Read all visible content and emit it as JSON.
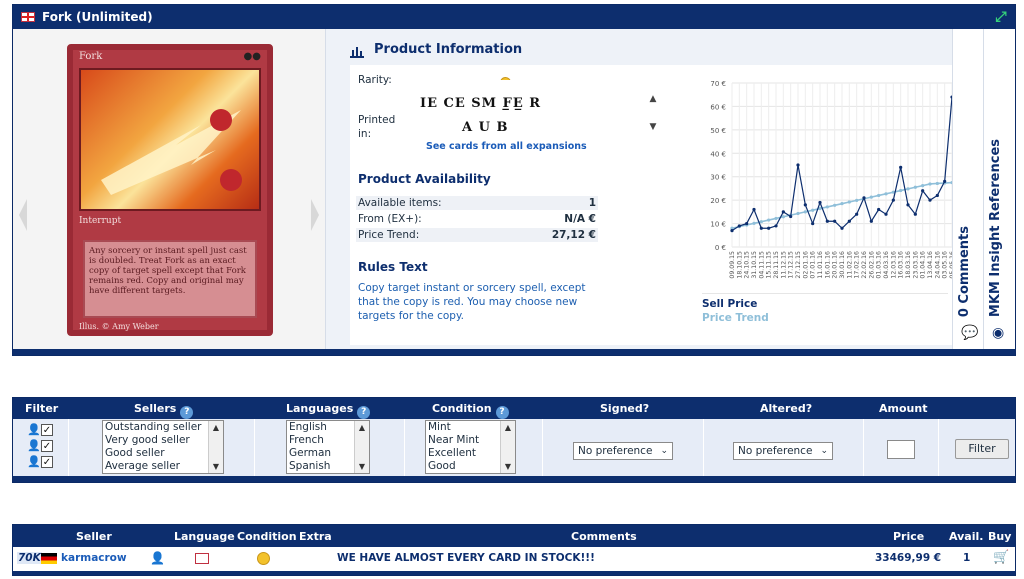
{
  "product": {
    "title": "Fork (Unlimited)",
    "card": {
      "name": "Fork",
      "cost": "●●",
      "type_line": "Interrupt",
      "text": "Any sorcery or instant spell just cast is doubled. Treat Fork as an exact copy of target spell except that Fork remains red. Copy and original may have different targets.",
      "illus": "Illus. © Amy Weber"
    }
  },
  "info": {
    "heading": "Product Information",
    "rarity_label": "Rarity:",
    "printed_label": "Printed in:",
    "expansions_row1": "IE CE SM F̲E̲ R",
    "expansions_row2": "A U B",
    "see_link": "See cards from all expansions",
    "availability_heading": "Product Availability",
    "rows": [
      {
        "key": "Available items:",
        "value": "1"
      },
      {
        "key": "From (EX+):",
        "value": "N/A €"
      },
      {
        "key": "Price Trend:",
        "value": "27,12 €"
      }
    ],
    "rules_heading": "Rules Text",
    "rules_text": "Copy target instant or sorcery spell, except that the copy is red. You may choose new targets for the copy."
  },
  "chart_data": {
    "type": "line",
    "y_ticks": [
      "70 €",
      "60 €",
      "50 €",
      "40 €",
      "30 €",
      "20 €",
      "10 €",
      "0 €"
    ],
    "ylim": [
      0,
      70
    ],
    "x": [
      "09.09.15",
      "18.10.15",
      "24.10.15",
      "31.10.15",
      "04.11.15",
      "15.11.15",
      "28.11.15",
      "11.12.15",
      "17.12.15",
      "27.12.15",
      "02.01.16",
      "07.01.16",
      "11.01.16",
      "16.01.16",
      "20.01.16",
      "30.01.16",
      "11.02.16",
      "17.02.16",
      "22.02.16",
      "26.02.16",
      "01.03.16",
      "04.03.16",
      "12.03.16",
      "16.03.16",
      "18.03.16",
      "23.03.16",
      "01.04.16",
      "13.04.16",
      "24.04.16",
      "03.05.16",
      "05.05.16"
    ],
    "series": [
      {
        "name": "Sell Price",
        "color": "#0d2e6e",
        "values": [
          7,
          9,
          10,
          16,
          8,
          8,
          9,
          15,
          13,
          35,
          18,
          10,
          19,
          11,
          11,
          8,
          11,
          14,
          21,
          11,
          16,
          14,
          20,
          34,
          18,
          14,
          24,
          20,
          22,
          28,
          64
        ]
      },
      {
        "name": "Price Trend",
        "color": "#8fbfd9",
        "values": [
          8,
          8.7,
          9.4,
          10.1,
          10.8,
          11.5,
          12.2,
          12.9,
          13.6,
          14.3,
          15,
          15.7,
          16.4,
          17.1,
          17.8,
          18.5,
          19.2,
          19.9,
          20.6,
          21.3,
          22,
          22.7,
          23.4,
          24.1,
          24.8,
          25.5,
          26.2,
          26.9,
          27.12,
          27.3,
          27.5
        ]
      }
    ],
    "legend_placement": "bottom",
    "grid": true
  },
  "side_tabs": {
    "comments": "0 Comments",
    "insight": "MKM Insight References"
  },
  "filter": {
    "headers": {
      "filter": "Filter",
      "sellers": "Sellers",
      "languages": "Languages",
      "condition": "Condition",
      "signed": "Signed?",
      "altered": "Altered?",
      "amount": "Amount"
    },
    "sellers": [
      "Outstanding seller",
      "Very good seller",
      "Good seller",
      "Average seller"
    ],
    "languages": [
      "English",
      "French",
      "German",
      "Spanish"
    ],
    "conditions": [
      "Mint",
      "Near Mint",
      "Excellent",
      "Good"
    ],
    "signed_value": "No preference",
    "altered_value": "No preference",
    "button": "Filter",
    "help": "?"
  },
  "offers": {
    "headers": {
      "seller": "Seller",
      "language": "Language",
      "condition": "Condition",
      "extra": "Extra",
      "comments": "Comments",
      "price": "Price",
      "avail": "Avail.",
      "buy": "Buy"
    },
    "rows": [
      {
        "sales": "70K",
        "seller": "karmacrow",
        "comment": "WE HAVE ALMOST EVERY CARD IN STOCK!!!",
        "price": "33469,99 €",
        "avail": "1"
      }
    ]
  }
}
